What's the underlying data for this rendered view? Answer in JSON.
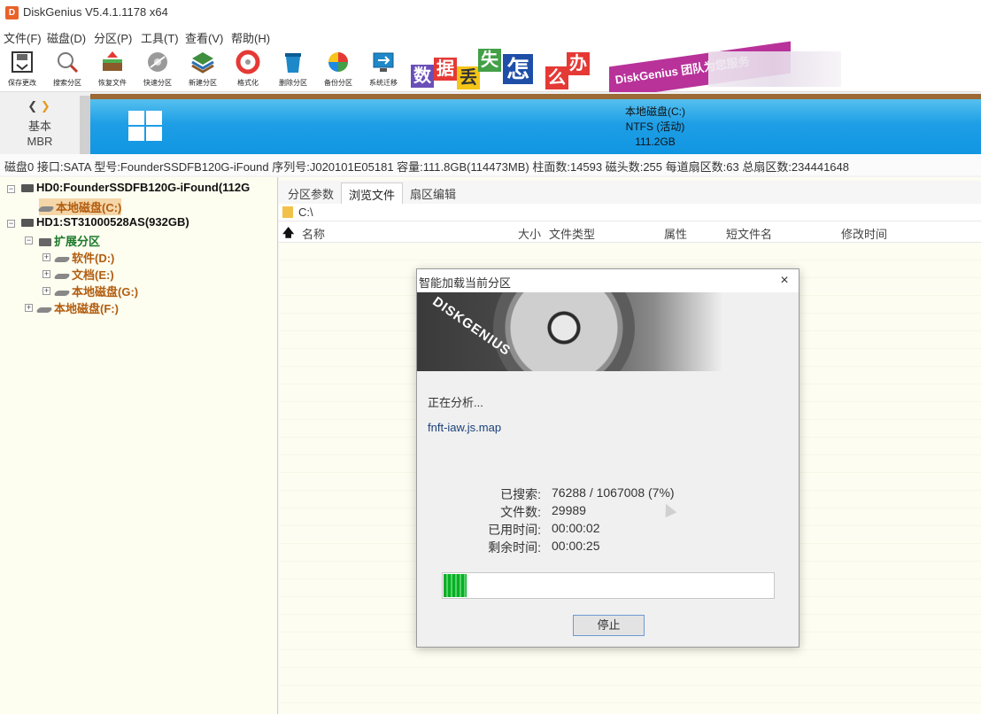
{
  "app": {
    "logo_letter": "D",
    "title": "DiskGenius V5.4.1.1178 x64"
  },
  "menu": [
    "文件(F)",
    "磁盘(D)",
    "分区(P)",
    "工具(T)",
    "查看(V)",
    "帮助(H)"
  ],
  "toolbar": [
    {
      "label": "保存更改",
      "icon": "save-icon"
    },
    {
      "label": "搜索分区",
      "icon": "search-icon"
    },
    {
      "label": "恢复文件",
      "icon": "recover-icon"
    },
    {
      "label": "快速分区",
      "icon": "quick-partition-icon"
    },
    {
      "label": "新建分区",
      "icon": "new-partition-icon"
    },
    {
      "label": "格式化",
      "icon": "format-icon"
    },
    {
      "label": "删除分区",
      "icon": "delete-icon"
    },
    {
      "label": "备份分区",
      "icon": "backup-icon"
    },
    {
      "label": "系统迁移",
      "icon": "migrate-icon"
    }
  ],
  "banner": {
    "tiles": [
      "数",
      "据",
      "丢",
      "失",
      "怎",
      "么",
      "办"
    ],
    "slogan": "DiskGenius 团队为您服务"
  },
  "diskmap": {
    "disk_type_line1": "基本",
    "disk_type_line2": "MBR",
    "partition_name": "本地磁盘(C:)",
    "partition_fs": "NTFS (活动)",
    "partition_size": "111.2GB"
  },
  "infoline": "磁盘0 接口:SATA  型号:FounderSSDFB120G-iFound  序列号:J020101E05181  容量:111.8GB(114473MB)  柱面数:14593  磁头数:255  每道扇区数:63  总扇区数:234441648",
  "tree": {
    "hd0": "HD0:FounderSSDFB120G-iFound(112G",
    "hd0_c": "本地磁盘(C:)",
    "hd1": "HD1:ST31000528AS(932GB)",
    "ext": "扩展分区",
    "d": "软件(D:)",
    "e": "文档(E:)",
    "g": "本地磁盘(G:)",
    "f": "本地磁盘(F:)"
  },
  "tabs": [
    "分区参数",
    "浏览文件",
    "扇区编辑"
  ],
  "path": "C:\\",
  "columns": [
    "名称",
    "大小",
    "文件类型",
    "属性",
    "短文件名",
    "修改时间"
  ],
  "dialog": {
    "title": "智能加载当前分区",
    "close": "×",
    "logo": "DISKGENIUS",
    "status": "正在分析...",
    "current_file": "fnft-iaw.js.map",
    "stats": [
      {
        "key": "已搜索:",
        "value": "76288 / 1067008 (7%)"
      },
      {
        "key": "文件数:",
        "value": "29989"
      },
      {
        "key": "已用时间:",
        "value": "00:00:02"
      },
      {
        "key": "剩余时间:",
        "value": "00:00:25"
      }
    ],
    "progress_fraction": 0.07,
    "stop": "停止"
  },
  "colors": {
    "accent": "#1e9ee6",
    "progress": "#06b025",
    "partition_label": "#b25d0f"
  }
}
